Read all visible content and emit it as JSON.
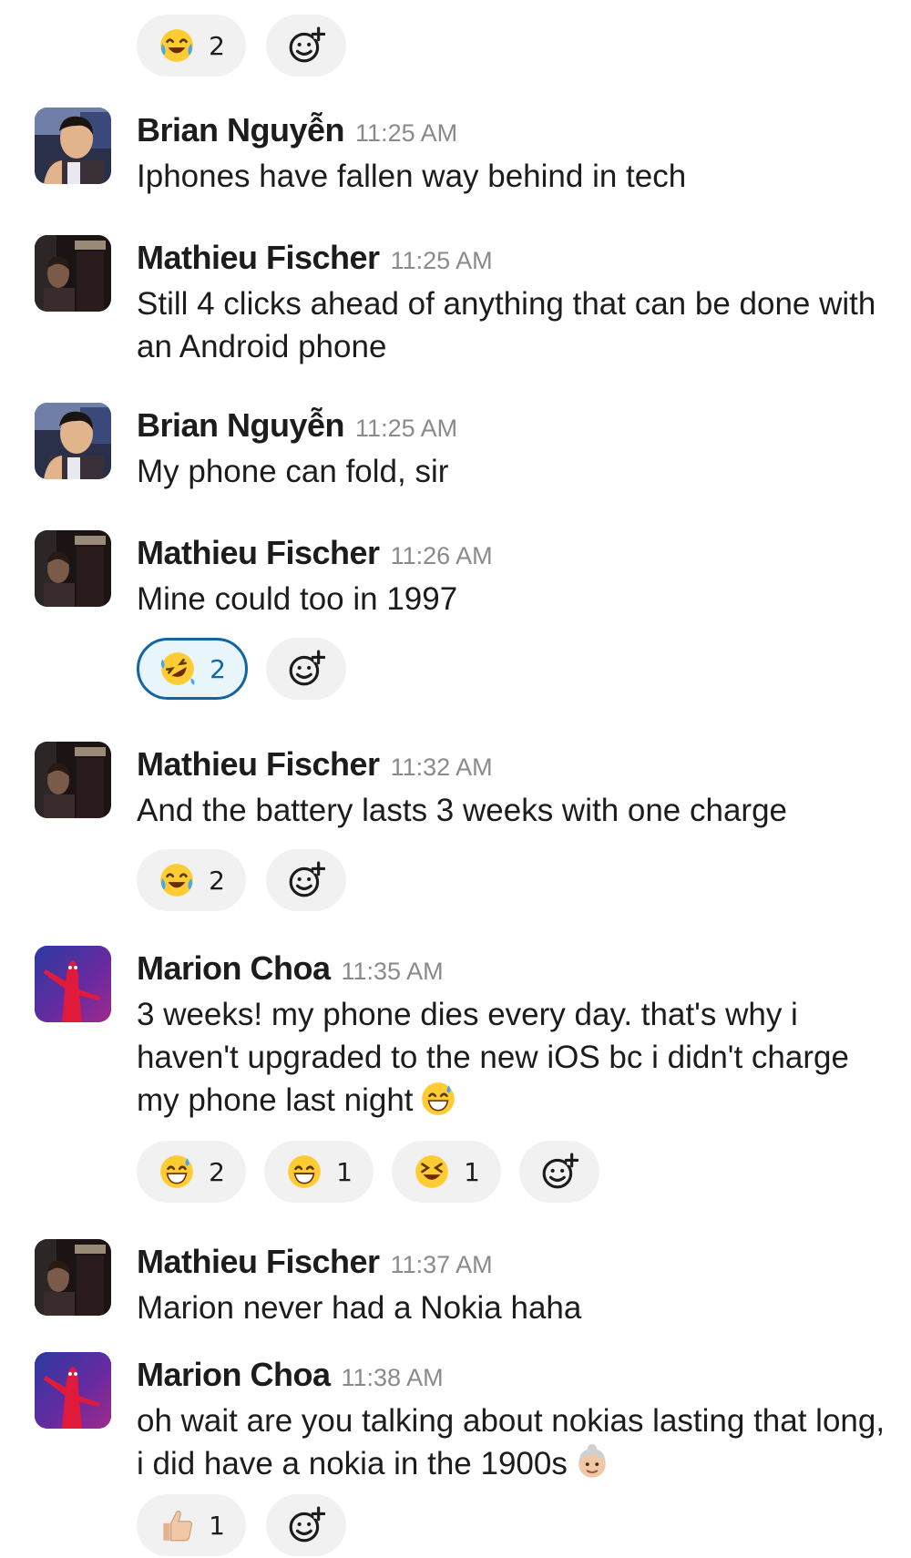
{
  "messages": [
    {
      "author": "Brian Nguyễn",
      "time": "11:25 AM",
      "text": "Iphones have fallen way behind in tech",
      "avatar": "brian-avatar"
    },
    {
      "author": "Mathieu Fischer",
      "time": "11:25 AM",
      "text": "Still 4 clicks ahead of anything that can be done with an Android phone",
      "avatar": "mathieu-avatar"
    },
    {
      "author": "Brian Nguyễn",
      "time": "11:25 AM",
      "text": "My phone can fold, sir",
      "avatar": "brian-avatar"
    },
    {
      "author": "Mathieu Fischer",
      "time": "11:26 AM",
      "text": "Mine could too in 1997",
      "avatar": "mathieu-avatar"
    },
    {
      "author": "Mathieu Fischer",
      "time": "11:32 AM",
      "text": "And the battery lasts 3 weeks with one charge",
      "avatar": "mathieu-avatar"
    },
    {
      "author": "Marion Choa",
      "time": "11:35 AM",
      "text": "3 weeks! my phone dies every day. that's why i haven't upgraded to the new iOS bc i didn't charge my phone last night",
      "avatar": "marion-avatar",
      "trailing_emoji": "grinning-sweat-emoji"
    },
    {
      "author": "Mathieu Fischer",
      "time": "11:37 AM",
      "text": "Marion never had a Nokia haha",
      "avatar": "mathieu-avatar"
    },
    {
      "author": "Marion Choa",
      "time": "11:38 AM",
      "text": "oh wait are you talking about nokias lasting that long, i did have a nokia in the 1900s",
      "avatar": "marion-avatar",
      "trailing_emoji": "older-woman-emoji"
    }
  ],
  "reactions": {
    "top": [
      {
        "emoji": "joy-emoji",
        "count": "2"
      }
    ],
    "msg4": [
      {
        "emoji": "rofl-emoji",
        "count": "2",
        "active": true
      }
    ],
    "msg5": [
      {
        "emoji": "joy-emoji",
        "count": "2"
      }
    ],
    "msg6": [
      {
        "emoji": "grinning-sweat-emoji",
        "count": "2"
      },
      {
        "emoji": "grin-emoji",
        "count": "1"
      },
      {
        "emoji": "laughing-emoji",
        "count": "1"
      }
    ],
    "msg8": [
      {
        "emoji": "thumbs-up-emoji",
        "count": "1"
      }
    ]
  },
  "colors": {
    "accent": "#1264a3",
    "pill_bg": "#f1f1f1",
    "timestamp": "#8a8a8a"
  }
}
